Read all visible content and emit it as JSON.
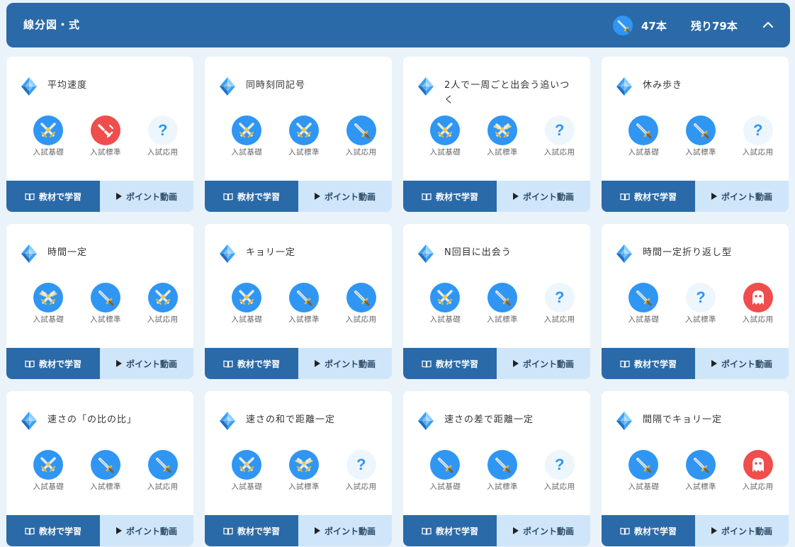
{
  "header": {
    "title": "線分図・式",
    "count": "47本",
    "remaining": "残り79本"
  },
  "actions": {
    "study": "教材で学習",
    "video": "ポイント動画"
  },
  "levels": [
    "入試基礎",
    "入試標準",
    "入試応用"
  ],
  "unknown_symbol": "?",
  "colors": {
    "header_bg": "#2a6aa8",
    "badge_blue": "#2f96f3",
    "badge_red": "#f04d4d",
    "video_bg": "#cfe6fa",
    "page_bg": "#eaf3fa"
  },
  "cards": [
    {
      "title": "平均速度",
      "badges": [
        "crossed-swords",
        "broken-sword",
        "unknown"
      ]
    },
    {
      "title": "同時刻同記号",
      "badges": [
        "crossed-swords",
        "crossed-swords",
        "sword"
      ]
    },
    {
      "title": "2人で一周ごと出会う追いつく",
      "badges": [
        "crossed-swords",
        "winged-swords",
        "unknown"
      ]
    },
    {
      "title": "休み歩き",
      "badges": [
        "sword",
        "sword",
        "unknown"
      ]
    },
    {
      "title": "時間一定",
      "badges": [
        "winged-swords",
        "sword",
        "crossed-swords"
      ]
    },
    {
      "title": "キョリ一定",
      "badges": [
        "crossed-swords",
        "sword",
        "sword"
      ]
    },
    {
      "title": "N回目に出会う",
      "badges": [
        "crossed-swords",
        "sword",
        "unknown"
      ]
    },
    {
      "title": "時間一定折り返し型",
      "badges": [
        "sword",
        "unknown",
        "ghost"
      ]
    },
    {
      "title": "速さの「の比の比」",
      "badges": [
        "crossed-swords",
        "sword",
        "sword"
      ]
    },
    {
      "title": "速さの和で距離一定",
      "badges": [
        "crossed-swords",
        "winged-swords",
        "unknown"
      ]
    },
    {
      "title": "速さの差で距離一定",
      "badges": [
        "sword",
        "sword",
        "unknown"
      ]
    },
    {
      "title": "間隔でキョリ一定",
      "badges": [
        "sword",
        "sword",
        "ghost"
      ]
    }
  ]
}
